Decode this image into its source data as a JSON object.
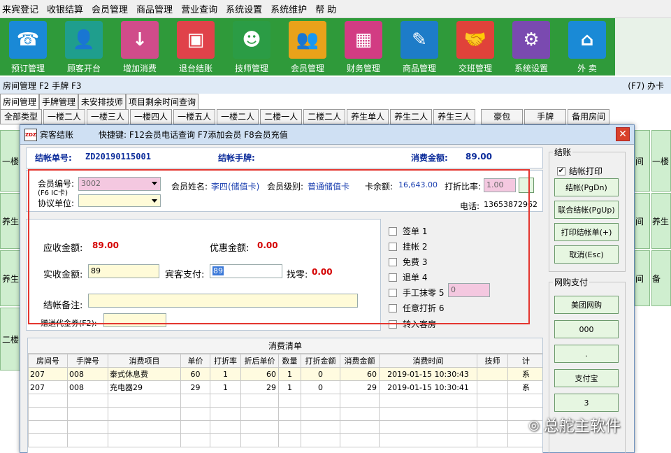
{
  "menu": [
    "来宾登记",
    "收银结算",
    "会员管理",
    "商品管理",
    "营业查询",
    "系统设置",
    "系统维护",
    "帮  助"
  ],
  "toolbar": [
    {
      "label": "预订管理",
      "icon": "phone-24-7-icon",
      "color": "#1a89d6",
      "glyph": "☎"
    },
    {
      "label": "顾客开台",
      "icon": "add-person-icon",
      "color": "#1f9e8d",
      "glyph": "👤"
    },
    {
      "label": "增加消费",
      "icon": "sale-tag-icon",
      "color": "#d04c8a",
      "glyph": "↓"
    },
    {
      "label": "退台结账",
      "icon": "wallet-icon",
      "color": "#e0424a",
      "glyph": "▣"
    },
    {
      "label": "技师管理",
      "icon": "headset-person-icon",
      "color": "#2b9c45",
      "glyph": "☻"
    },
    {
      "label": "会员管理",
      "icon": "members-icon",
      "color": "#e9a21a",
      "glyph": "👥"
    },
    {
      "label": "财务管理",
      "icon": "calculator-icon",
      "color": "#d23c83",
      "glyph": "▦"
    },
    {
      "label": "商品管理",
      "icon": "clipboard-icon",
      "color": "#1d7cc8",
      "glyph": "✎"
    },
    {
      "label": "交班管理",
      "icon": "handshake-icon",
      "color": "#e0423a",
      "glyph": "🤝"
    },
    {
      "label": "系统设置",
      "icon": "gear-icon",
      "color": "#7a4ab0",
      "glyph": "⚙"
    },
    {
      "label": "外  卖",
      "icon": "store-icon",
      "color": "#1a8ad6",
      "glyph": "⌂"
    }
  ],
  "subbar": {
    "left": "房间管理 F2   手牌 F3",
    "right": "(F7) 办卡"
  },
  "tabs1": [
    "房间管理",
    "手牌管理",
    "未安排技师",
    "项目剩余时间查询"
  ],
  "tabs2": [
    "全部类型",
    "一楼二人",
    "一楼三人",
    "一楼四人",
    "一楼五人",
    "一楼二人",
    "二楼一人",
    "二楼二人",
    "养生单人",
    "养生二人",
    "养生三人",
    "豪包",
    "手牌",
    "备用房间"
  ],
  "dialog": {
    "title": "宾客结账",
    "shortcut_hint": "快捷键: F12会员电话查询  F7添加会员  F8会员充值",
    "bill_no_label": "结帐单号:",
    "bill_no": "ZD20190115001",
    "tag_label": "结帐手牌:",
    "amount_label": "消费金额:",
    "amount": "89.00",
    "member_no_label": "会员编号:",
    "member_no_sub": "(F6 IC卡)",
    "member_no": "3002",
    "agreement_label": "协议单位:",
    "member_name_label": "会员姓名:",
    "member_name": "李四(储值卡)",
    "member_level_label": "会员级别:",
    "member_level": "普通储值卡",
    "balance_label": "卡余额:",
    "balance": "16,643.00",
    "discount_label": "打折比率:",
    "discount": "1.00",
    "phone_label": "电话:",
    "phone": "13653872962",
    "receivable_label": "应收金额:",
    "receivable": "89.00",
    "preferential_label": "优惠金额:",
    "preferential": "0.00",
    "actual_label": "实收金额:",
    "actual": "89",
    "guest_pay_label": "宾客支付:",
    "guest_pay": "89",
    "change_label": "找零:",
    "change": "0.00",
    "remark_label": "结帐备注:",
    "voucher_label": "赠送代金券(F2):",
    "options": [
      "签单 1",
      "挂帐 2",
      "免费 3",
      "退单 4",
      "手工抹零 5",
      "任意打折 6",
      "转入客房"
    ],
    "manual_zero_value": "0",
    "list_title": "消费清单",
    "columns": [
      "房间号",
      "手牌号",
      "消费项目",
      "单价",
      "打折率",
      "折后单价",
      "数量",
      "打折金额",
      "消费金额",
      "消费时间",
      "技师",
      "计"
    ],
    "rows": [
      [
        "207",
        "008",
        "泰式休息费",
        "60",
        "1",
        "60",
        "1",
        "0",
        "60",
        "2019-01-15 10:30:43",
        "",
        "系"
      ],
      [
        "207",
        "008",
        "充电器29",
        "29",
        "1",
        "29",
        "1",
        "0",
        "29",
        "2019-01-15 10:30:41",
        "",
        "系"
      ]
    ]
  },
  "checkout_group": {
    "title": "结账",
    "print_label": "结帐打印",
    "buttons": [
      "结帐(PgDn)",
      "联合结帐(PgUp)",
      "打印结帐单(+)",
      "取消(Esc)"
    ]
  },
  "online_group": {
    "title": "网购支付",
    "buttons": [
      "美团网购",
      "000",
      ".",
      "支付宝",
      "3"
    ]
  },
  "bg_tiles": [
    "一楼",
    "养生",
    "养生",
    "二楼",
    "间",
    "一楼",
    "间",
    "养生",
    "间",
    "备"
  ],
  "watermark": "总舵主软件"
}
